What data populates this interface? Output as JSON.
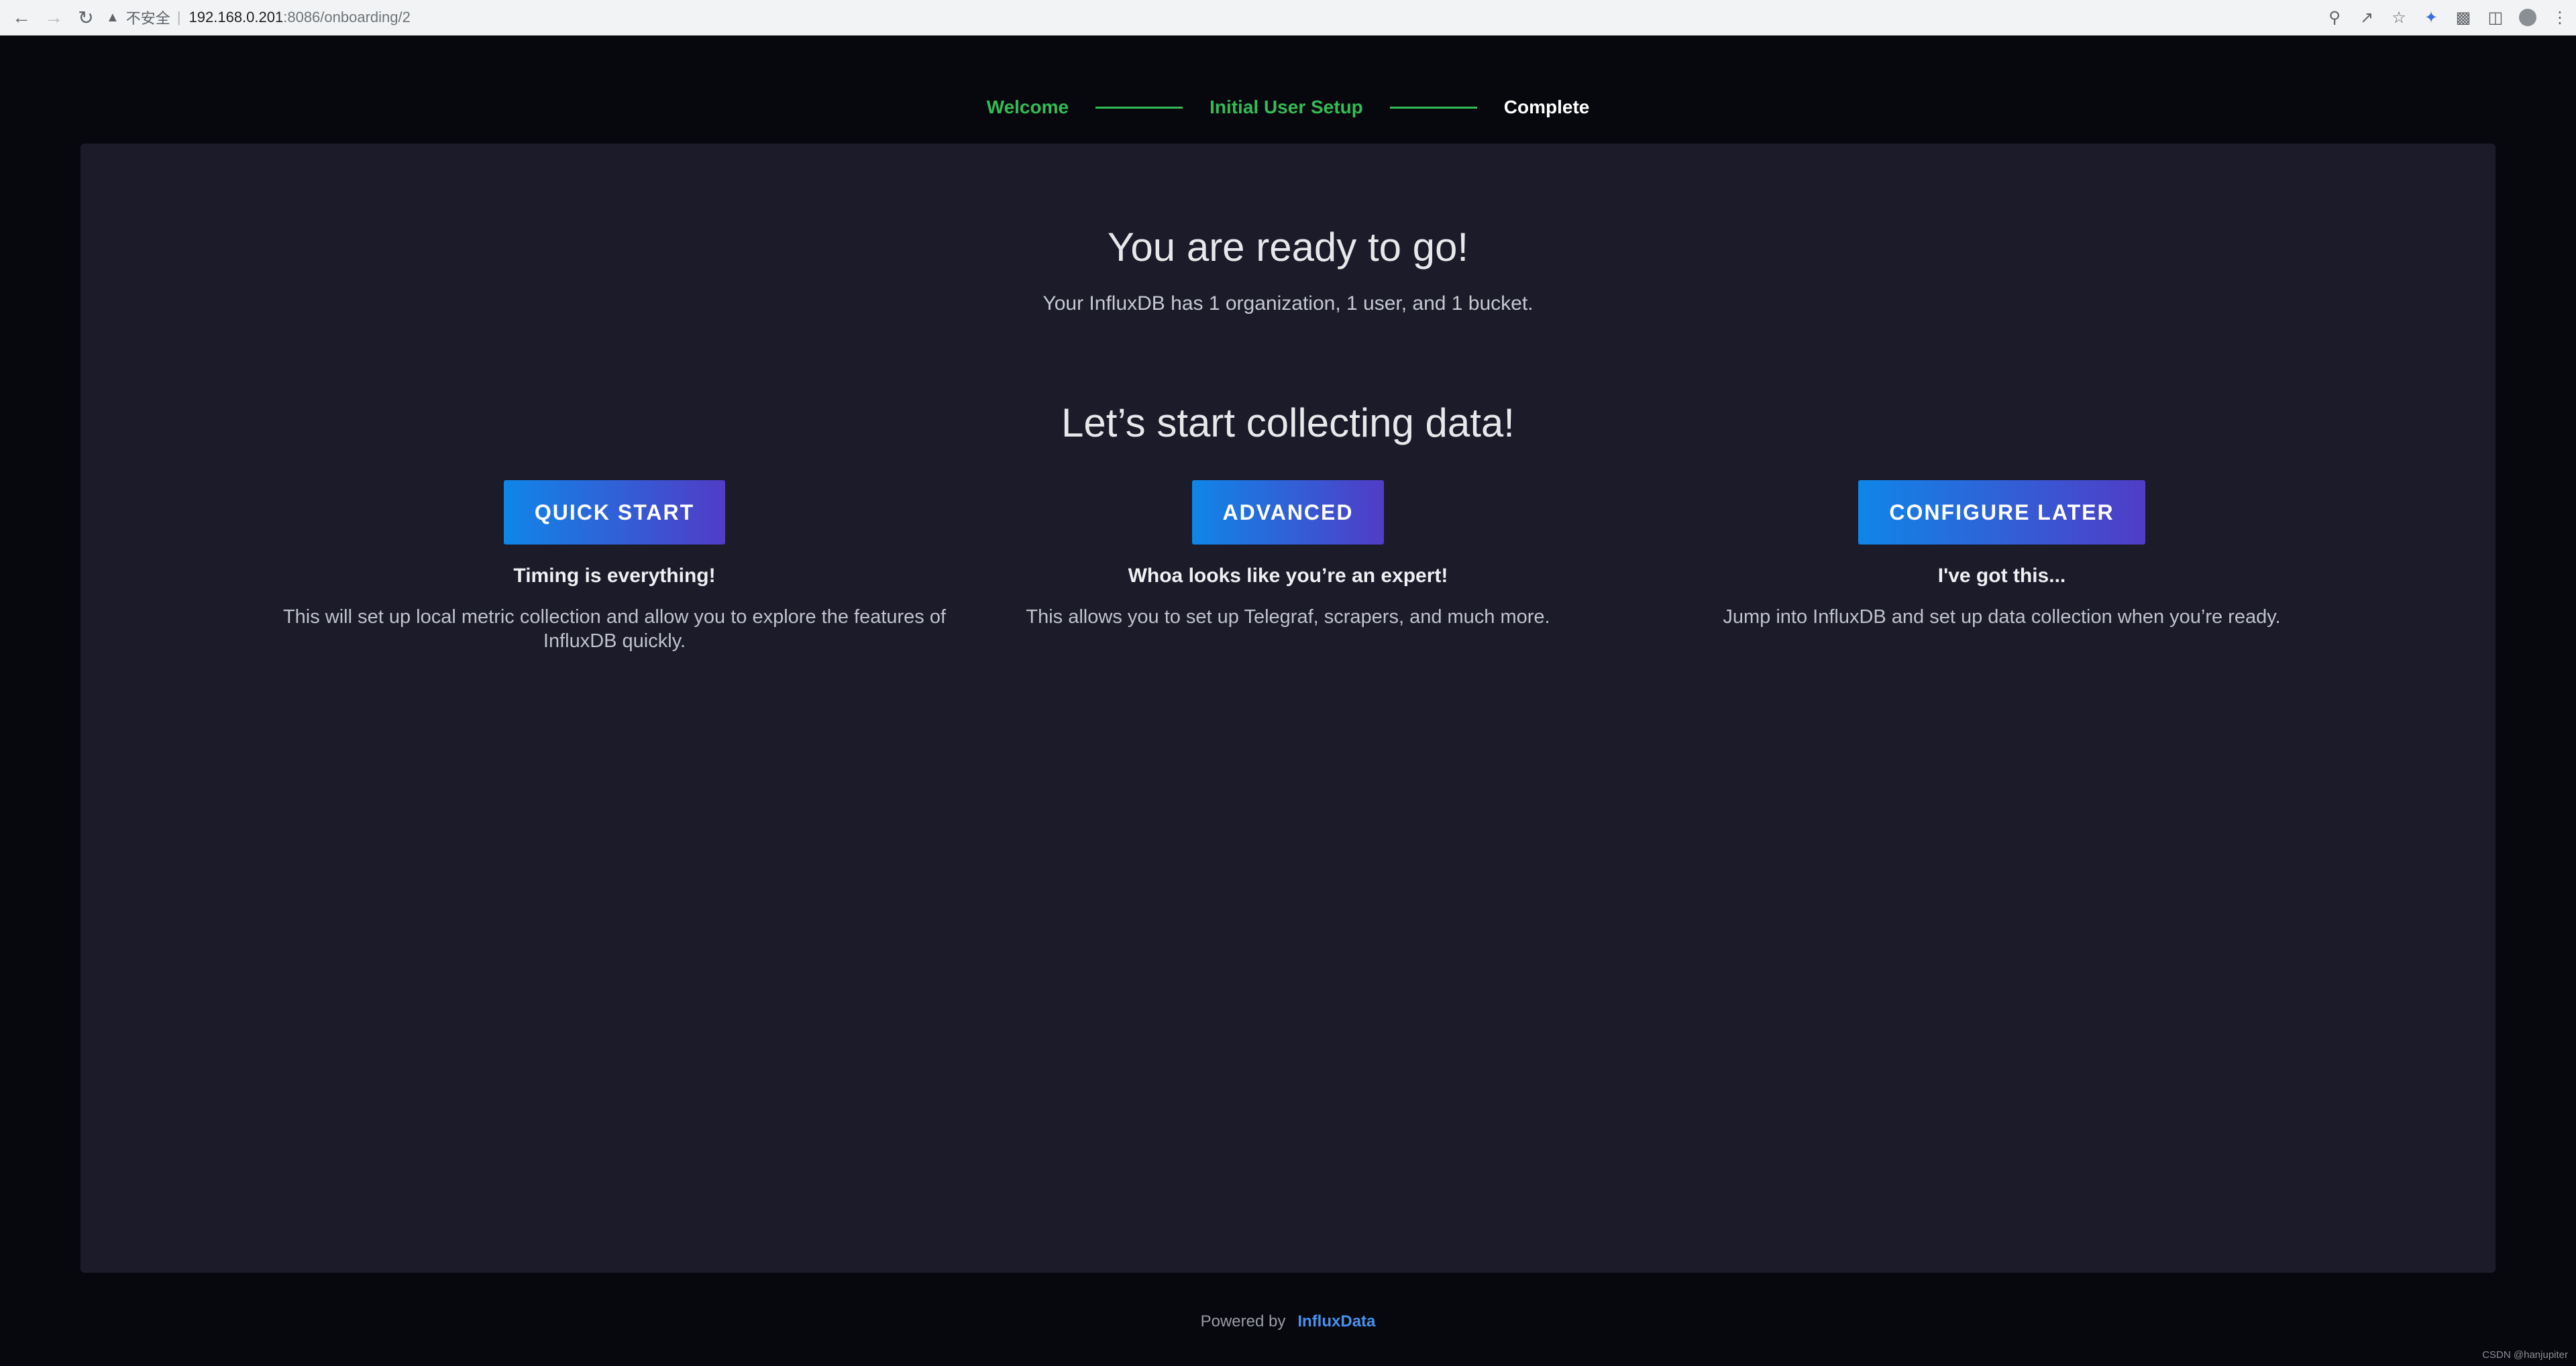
{
  "browser": {
    "url_warning": "不安全",
    "url_host": "192.168.0.201",
    "url_path": ":8086/onboarding/2",
    "icons": [
      "back-icon",
      "forward-icon",
      "reload-icon",
      "key-icon",
      "share-icon",
      "star-icon",
      "extension-app-icon",
      "puzzle-icon",
      "side-panel-icon",
      "profile-icon",
      "menu-icon"
    ]
  },
  "steps": [
    {
      "label": "Welcome",
      "state": "done"
    },
    {
      "label": "Initial User Setup",
      "state": "done"
    },
    {
      "label": "Complete",
      "state": "current"
    }
  ],
  "main": {
    "title": "You are ready to go!",
    "summary": "Your InfluxDB has 1 organization, 1 user, and 1 bucket.",
    "collect_title": "Let’s start collecting data!",
    "options": [
      {
        "button": "QUICK START",
        "heading": "Timing is everything!",
        "description": "This will set up local metric collection and allow you to explore the features of InfluxDB quickly."
      },
      {
        "button": "ADVANCED",
        "heading": "Whoa looks like you’re an expert!",
        "description": "This allows you to set up Telegraf, scrapers, and much more."
      },
      {
        "button": "CONFIGURE LATER",
        "heading": "I've got this...",
        "description": "Jump into InfluxDB and set up data collection when you’re ready."
      }
    ]
  },
  "footer": {
    "powered_by": "Powered by",
    "brand": "InfluxData"
  },
  "watermark": "CSDN @hanjupiter",
  "colors": {
    "background": "#07080d",
    "panel": "#1b1b29",
    "step_done": "#34bb55",
    "button_start": "#0f86e8",
    "button_end": "#513cc6",
    "brand_link": "#4591ed"
  }
}
